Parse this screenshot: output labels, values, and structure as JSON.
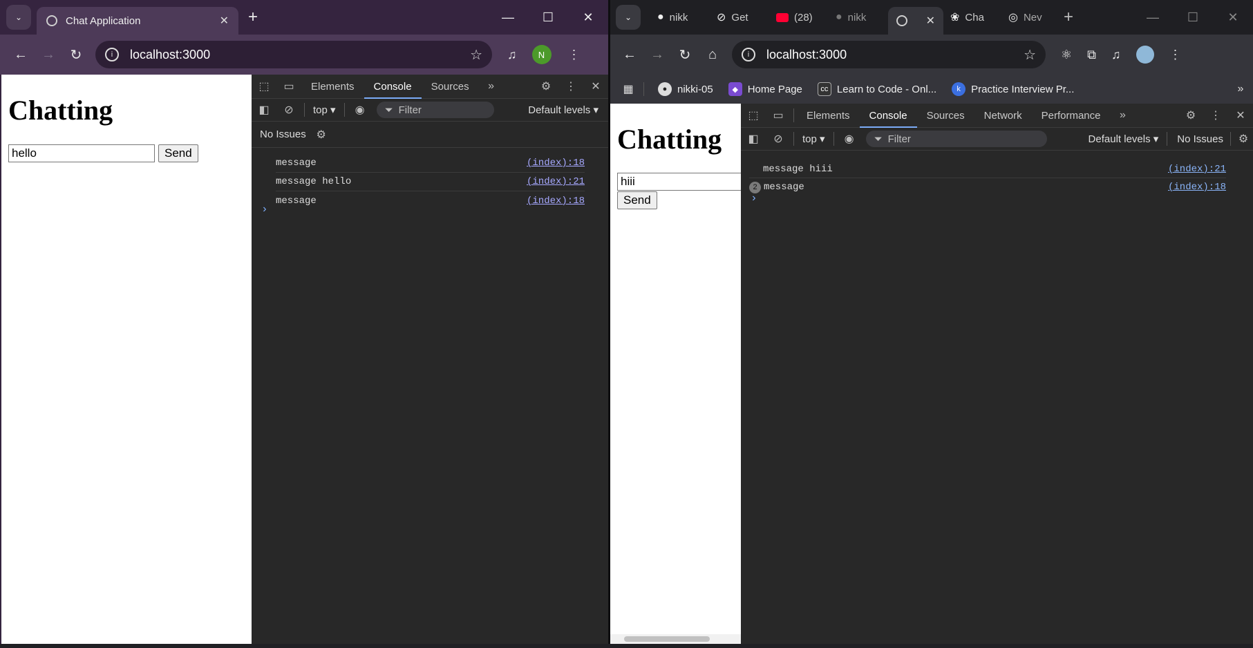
{
  "left_window": {
    "tab": {
      "title": "Chat Application",
      "close": "✕"
    },
    "url": "localhost:3000",
    "profile_initial": "N",
    "page": {
      "heading": "Chatting",
      "input_value": "hello",
      "send_label": "Send"
    },
    "devtools": {
      "tabs": [
        "Elements",
        "Console",
        "Sources"
      ],
      "context": "top",
      "filter_placeholder": "Filter",
      "levels": "Default levels",
      "issues": "No Issues",
      "logs": [
        {
          "text": "message",
          "source": "(index):18"
        },
        {
          "text": "message hello",
          "source": "(index):21"
        },
        {
          "text": "message",
          "source": "(index):18"
        }
      ]
    }
  },
  "right_window": {
    "tabs": [
      {
        "title": "nikk",
        "icon": "github-icon"
      },
      {
        "title": "Get",
        "icon": "compass-icon"
      },
      {
        "title": "(28)",
        "icon": "youtube-icon"
      },
      {
        "title": "nikk",
        "icon": "github-icon"
      },
      {
        "title": "",
        "icon": "globe-icon",
        "active": true
      },
      {
        "title": "Cha",
        "icon": "openai-icon"
      },
      {
        "title": "Nev",
        "icon": "chrome-icon"
      }
    ],
    "url": "localhost:3000",
    "bookmarks": [
      {
        "label": "nikki-05",
        "icon": "github-icon"
      },
      {
        "label": "Home Page",
        "icon": "home-icon"
      },
      {
        "label": "Learn to Code - Onl...",
        "icon": "cc-icon"
      },
      {
        "label": "Practice Interview Pr...",
        "icon": "pi-icon"
      }
    ],
    "page": {
      "heading": "Chatting",
      "input_value": "hiii",
      "send_label": "Send"
    },
    "devtools": {
      "tabs": [
        "Elements",
        "Console",
        "Sources",
        "Network",
        "Performance"
      ],
      "context": "top",
      "filter_placeholder": "Filter",
      "levels": "Default levels",
      "issues": "No Issues",
      "logs": [
        {
          "text": "message hiii",
          "source": "(index):21",
          "count": ""
        },
        {
          "text": "message",
          "source": "(index):18",
          "count": "2"
        }
      ]
    }
  }
}
